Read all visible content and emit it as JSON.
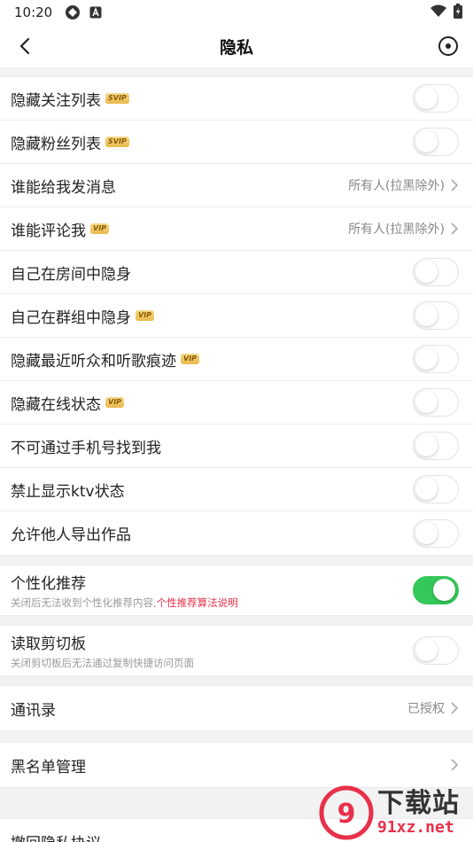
{
  "status_bar": {
    "time": "10:20"
  },
  "nav": {
    "title": "隐私"
  },
  "group1": [
    {
      "label": "隐藏关注列表",
      "badge": "SVIP",
      "type": "toggle",
      "on": false
    },
    {
      "label": "隐藏粉丝列表",
      "badge": "SVIP",
      "type": "toggle",
      "on": false
    },
    {
      "label": "谁能给我发消息",
      "badge": "",
      "type": "select",
      "value": "所有人(拉黑除外)"
    },
    {
      "label": "谁能评论我",
      "badge": "VIP",
      "type": "select",
      "value": "所有人(拉黑除外)"
    },
    {
      "label": "自己在房间中隐身",
      "badge": "",
      "type": "toggle",
      "on": false
    },
    {
      "label": "自己在群组中隐身",
      "badge": "VIP",
      "type": "toggle",
      "on": false
    },
    {
      "label": "隐藏最近听众和听歌痕迹",
      "badge": "VIP",
      "type": "toggle",
      "on": false
    },
    {
      "label": "隐藏在线状态",
      "badge": "VIP",
      "type": "toggle",
      "on": false
    },
    {
      "label": "不可通过手机号找到我",
      "badge": "",
      "type": "toggle",
      "on": false
    },
    {
      "label": "禁止显示ktv状态",
      "badge": "",
      "type": "toggle",
      "on": false
    },
    {
      "label": "允许他人导出作品",
      "badge": "",
      "type": "toggle",
      "on": false
    }
  ],
  "personalize": {
    "label": "个性化推荐",
    "sub": "关闭后无法收到个性化推荐内容,",
    "link": "个性推荐算法说明",
    "on": true
  },
  "clipboard": {
    "label": "读取剪切板",
    "sub": "关闭剪切板后无法通过复制快捷访问页面",
    "on": false
  },
  "contacts": {
    "label": "通讯录",
    "value": "已授权"
  },
  "blacklist": {
    "label": "黑名单管理"
  },
  "revoke": {
    "label": "撤回隐私协议"
  },
  "watermark": {
    "cn": "下载站",
    "url": "91xz.net"
  },
  "colors": {
    "toggle_on": "#34c759",
    "link": "#e8304a",
    "badge": "#e9b94a"
  }
}
